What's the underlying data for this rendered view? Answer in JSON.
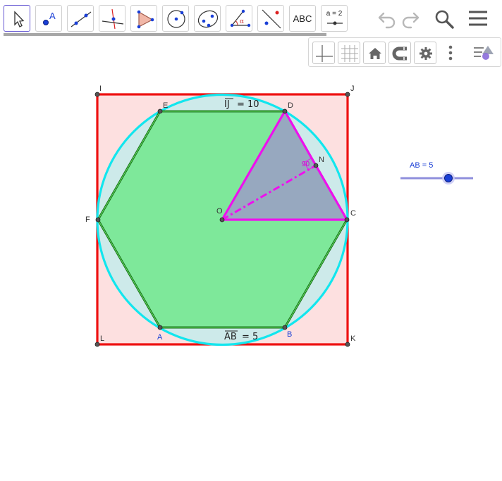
{
  "toolbar": {
    "tools": [
      {
        "name": "move-tool"
      },
      {
        "name": "point-tool",
        "label": "A"
      },
      {
        "name": "line-tool"
      },
      {
        "name": "perpendicular-line-tool"
      },
      {
        "name": "polygon-tool"
      },
      {
        "name": "circle-center-point-tool"
      },
      {
        "name": "conic-tool"
      },
      {
        "name": "angle-tool",
        "label": "α"
      },
      {
        "name": "reflect-tool"
      },
      {
        "name": "text-tool",
        "label": "ABC"
      },
      {
        "name": "slider-tool",
        "label": "a = 2"
      }
    ],
    "active_tool": "move-tool"
  },
  "header_buttons": [
    "undo-icon",
    "redo-icon",
    "search-icon",
    "menu-icon"
  ],
  "style_bar": {
    "buttons": [
      "axes-toggle-icon",
      "grid-toggle-icon",
      "home-icon",
      "point-capture-icon",
      "settings-gear-icon",
      "more-vertical-icon",
      "toggle-style-bar-icon"
    ]
  },
  "construction": {
    "points": {
      "I": "I",
      "J": "J",
      "K": "K",
      "L": "L",
      "A": "A",
      "B": "B",
      "C": "C",
      "D": "D",
      "E": "E",
      "F": "F",
      "O": "O",
      "N": "N"
    },
    "caption_top": {
      "segment": "IJ",
      "text": "= 10"
    },
    "caption_bottom": {
      "segment": "AB",
      "text": "= 5"
    },
    "angle_label": "90",
    "slider": {
      "label": "AB = 5",
      "value": 5
    },
    "colors": {
      "square_stroke": "#ee1111",
      "square_fill": "#fde0e0",
      "circle_stroke": "#12e6ee",
      "circle_fill": "#cdeaea",
      "hexagon_stroke": "#1a6e1a",
      "hexagon_fill": "#7ee89a",
      "triangle_stroke": "#ee10ee",
      "triangle_fill": "#97a8bf",
      "point_blue_label": "#1a3fd6"
    }
  }
}
